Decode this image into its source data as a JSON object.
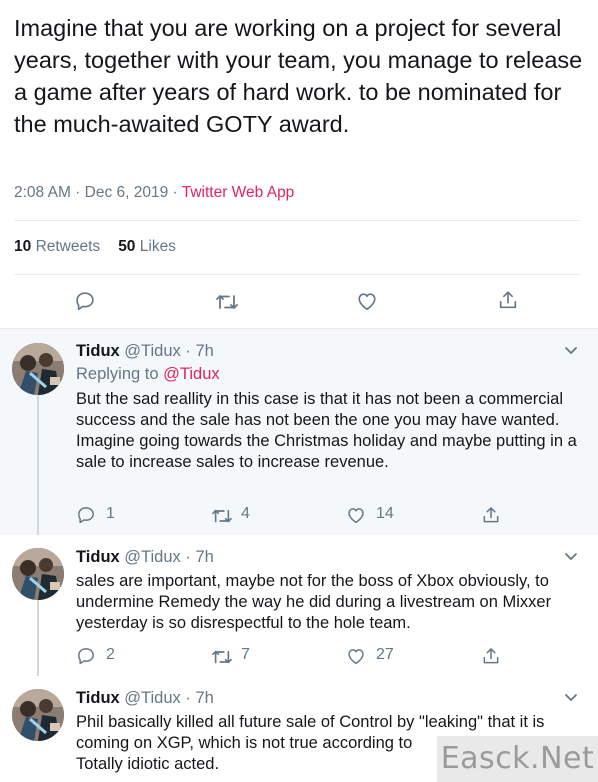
{
  "main_tweet": {
    "text": "Imagine that you are working on a project for several years, together with your team, you manage to release a game after years of hard work. to be nominated for the much-awaited GOTY award.",
    "time": "2:08 AM · Dec 6, 2019 · ",
    "source": "Twitter Web App",
    "retweets_count": "10",
    "retweets_label": "Retweets",
    "likes_count": "50",
    "likes_label": "Likes",
    "action_icons": [
      "reply-icon",
      "retweet-icon",
      "like-icon",
      "share-icon"
    ]
  },
  "replies": [
    {
      "name": "Tidux",
      "handle_time": "@Tidux · 7h",
      "replying_prefix": "Replying to ",
      "replying_handle": "@Tidux",
      "text_1": "But the sad reallity in this case is that it has not been a commercial success and the sale has not been the one you may have wanted.",
      "text_2": "Imagine going towards the Christmas holiday and maybe putting in a sale to increase sales to increase revenue.",
      "reply_count": "1",
      "retweet_count": "4",
      "like_count": "14"
    },
    {
      "name": "Tidux",
      "handle_time": "@Tidux · 7h",
      "text_1": "sales are important, maybe not for the boss of Xbox obviously, to undermine Remedy the way he did during a livestream on Mixxer yesterday is so disrespectful to the hole team.",
      "reply_count": "2",
      "retweet_count": "7",
      "like_count": "27"
    },
    {
      "name": "Tidux",
      "handle_time": "@Tidux · 7h",
      "text_1": "Phil basically killed all future sale of Control by \"leaking\" that it is coming on XGP, which is not true according to",
      "text_2": "Totally idiotic acted."
    }
  ],
  "watermark": "Easck.Net",
  "colors": {
    "text": "#14171a",
    "secondary": "#657786",
    "accent": "#e0245e",
    "divider": "#e6ecf0",
    "card_bg": "#f5f8fa"
  }
}
